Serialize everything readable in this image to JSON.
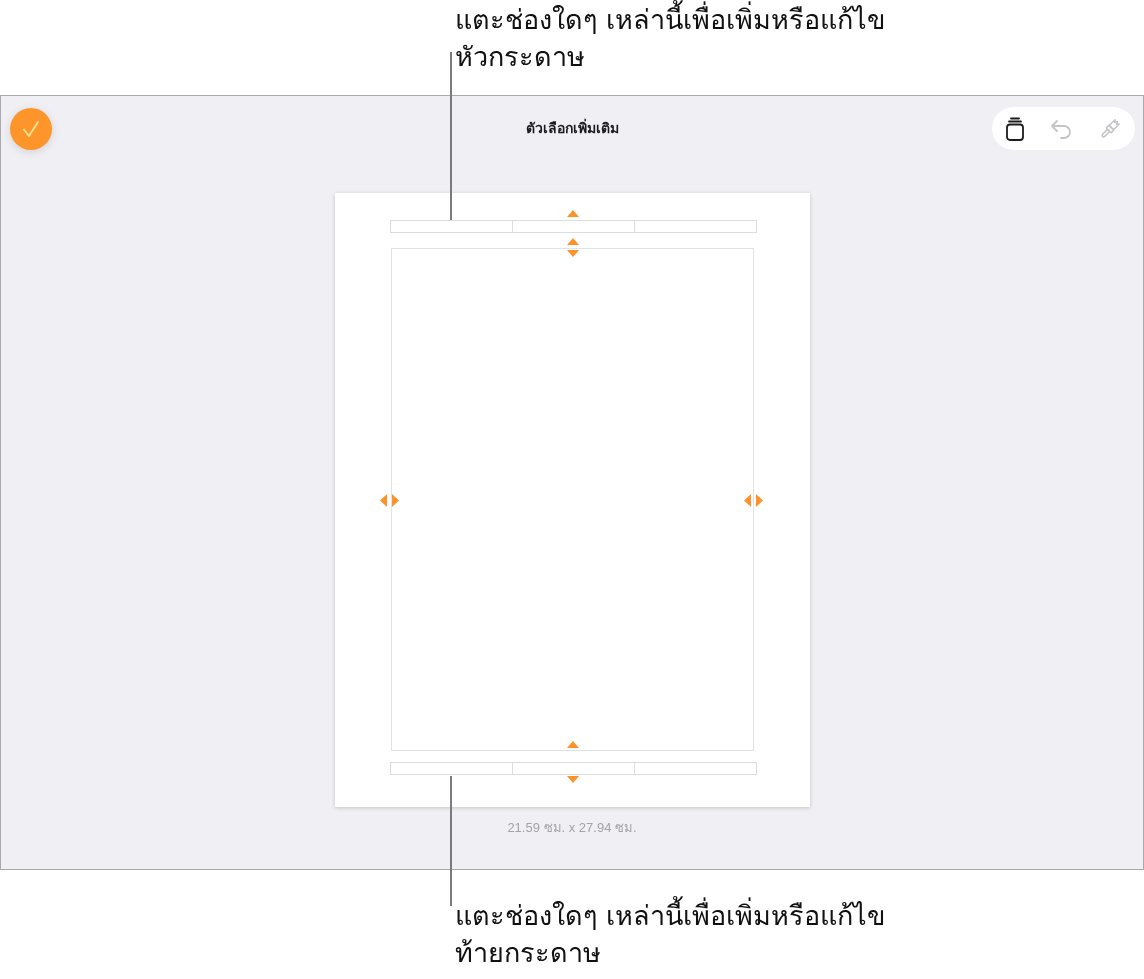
{
  "top_callout": {
    "lines": [
      "แตะช่องใดๆ เหล่านี้เพื่อเพิ่มหรือแก้ไข",
      "หัวกระดาษ"
    ]
  },
  "screen": {
    "title": "ตัวเลือกเพิ่มเติม",
    "toolbar": [
      {
        "kind": "document",
        "disabled": false
      },
      {
        "kind": "undo",
        "disabled": true
      },
      {
        "kind": "brush",
        "disabled": true
      }
    ],
    "page_size": "21.59 ซม. x 27.94 ซม."
  },
  "bottom_callout": {
    "lines": [
      "แตะช่องใดๆ เหล่านี้เพื่อเพิ่มหรือแก้ไข",
      "ท้ายกระดาษ"
    ]
  }
}
